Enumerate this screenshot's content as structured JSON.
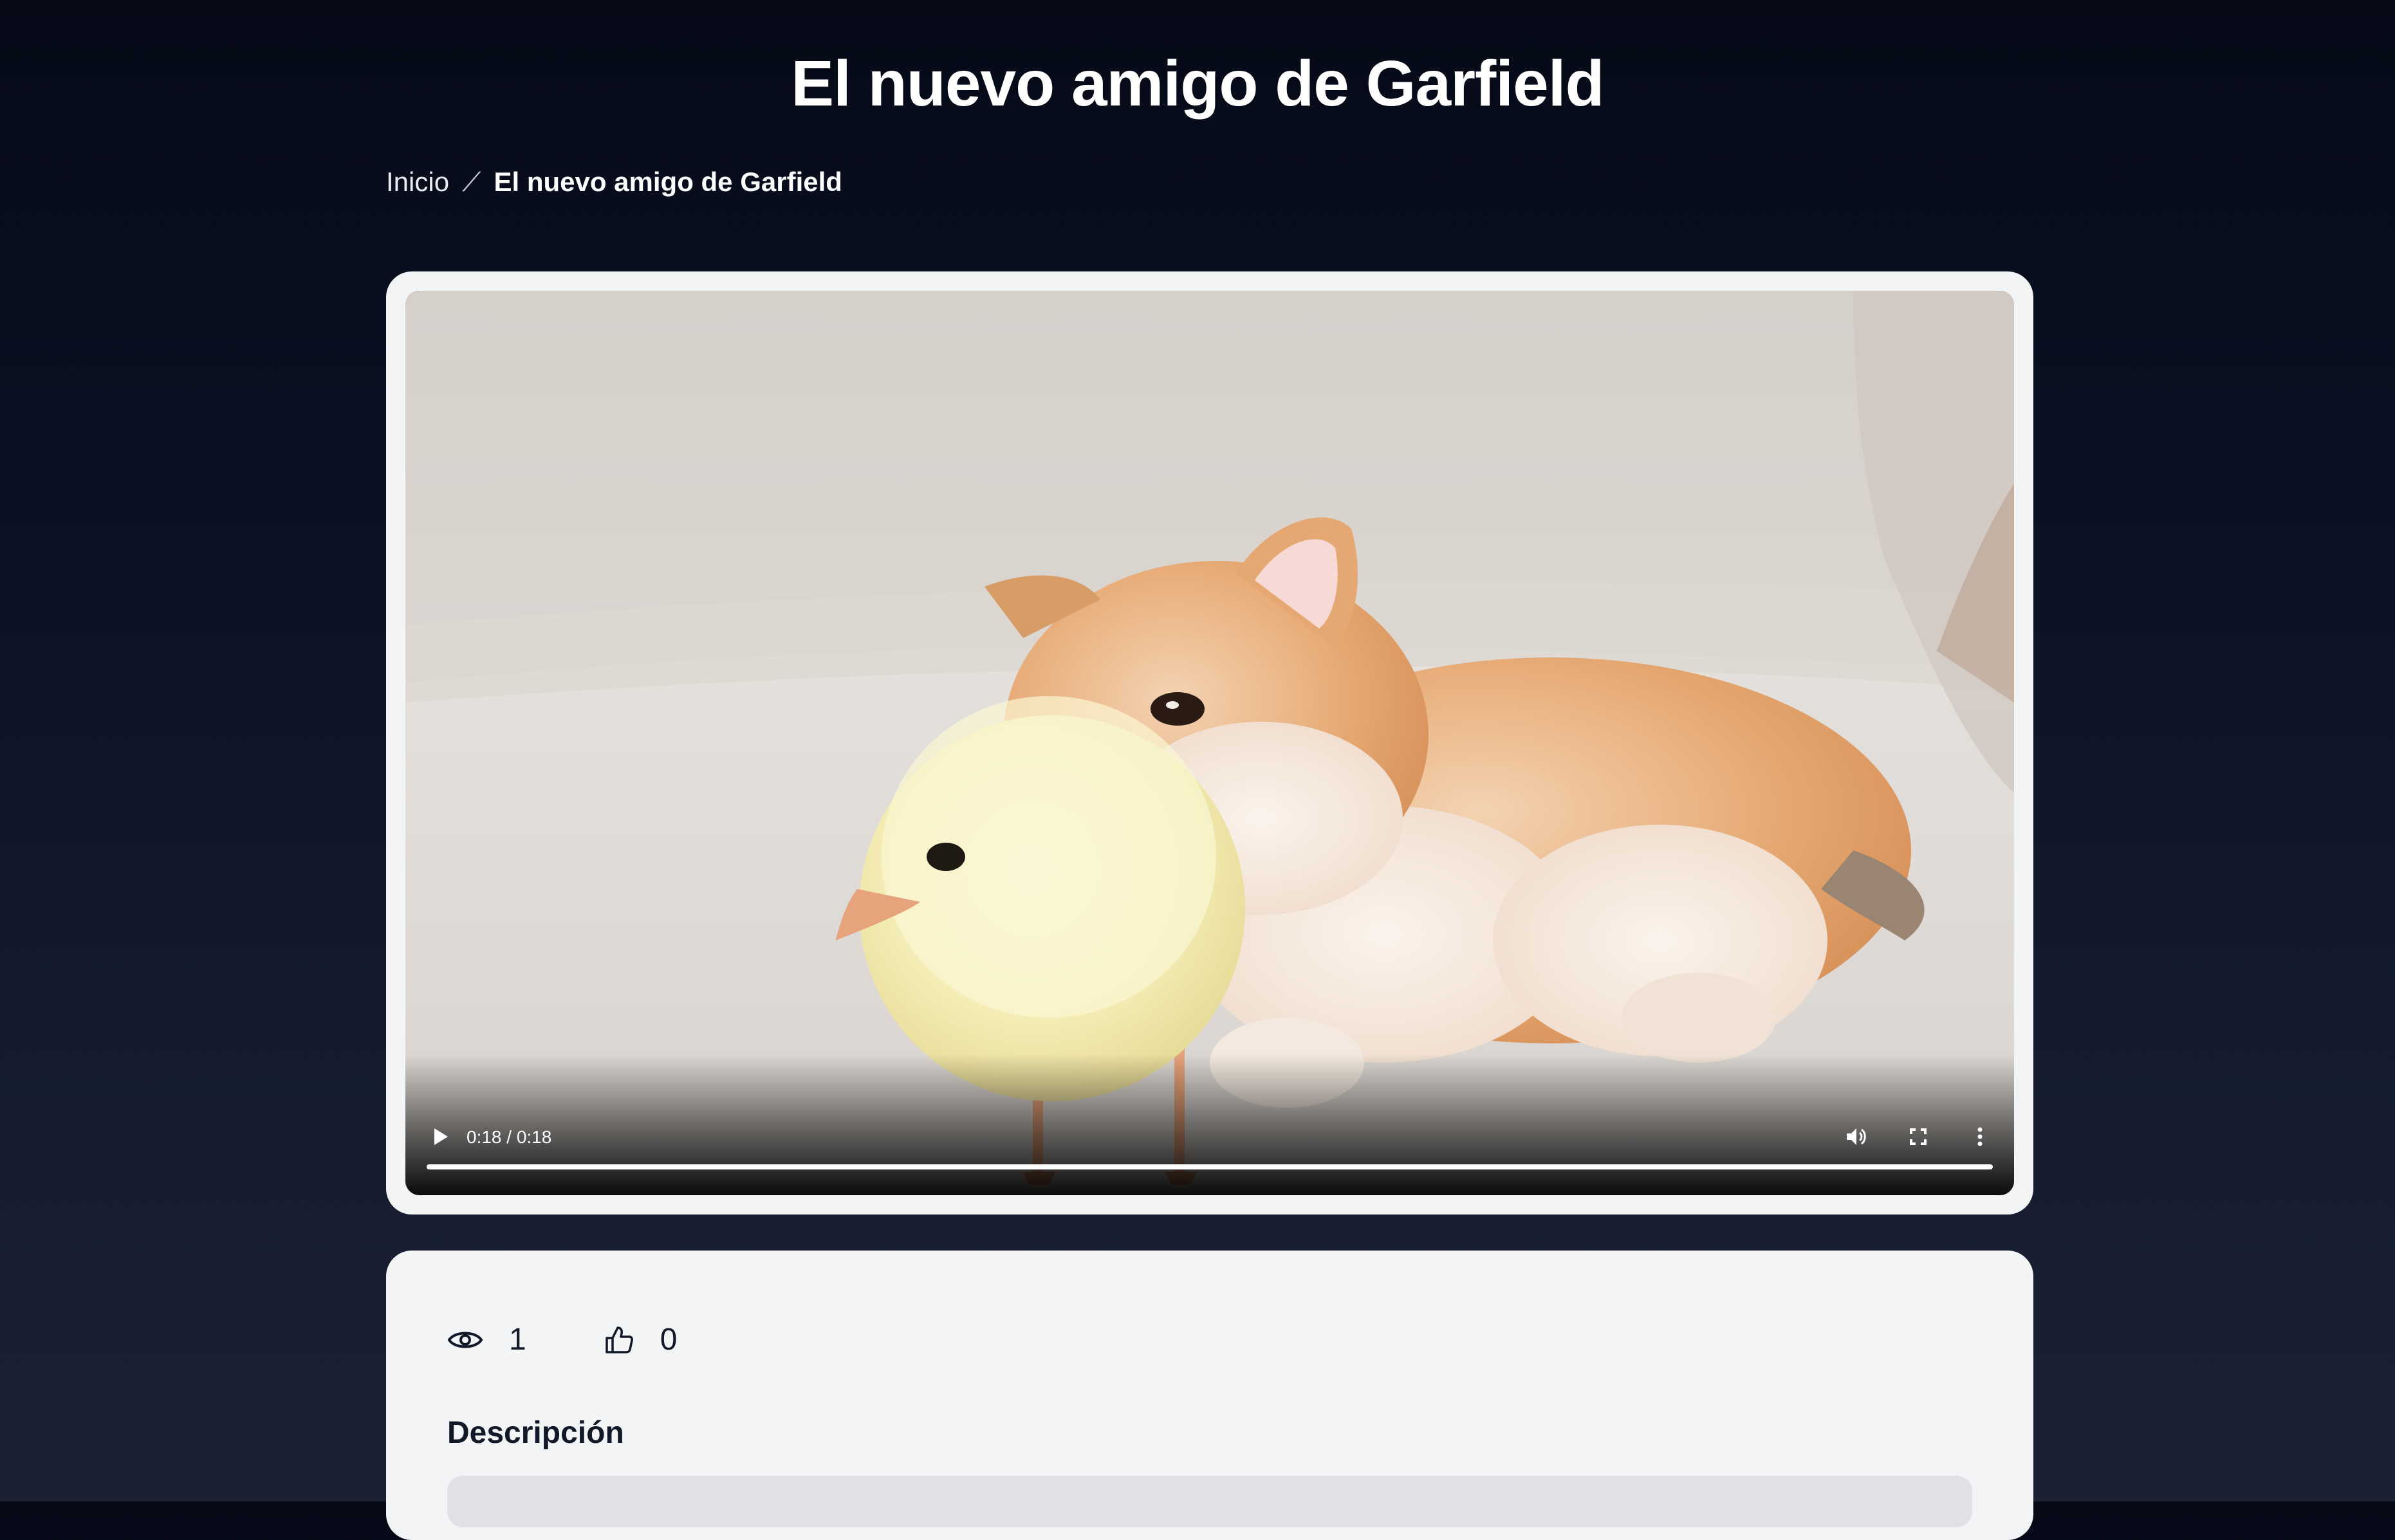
{
  "page": {
    "title": "El nuevo amigo de Garfield"
  },
  "breadcrumb": {
    "home": "Inicio",
    "separator": "⟋",
    "current": "El nuevo amigo de Garfield"
  },
  "video": {
    "time": "0:18 / 0:18",
    "progress": 1.0,
    "icons": [
      "play-icon",
      "volume-icon",
      "fullscreen-icon",
      "more-vert-icon"
    ]
  },
  "stats": {
    "views": "1",
    "likes": "0"
  },
  "description": {
    "heading": "Descripción"
  },
  "colors": {
    "card_bg": "#f3f4f6",
    "page_bg_top": "#060a17",
    "page_bg_bottom": "#1a2133",
    "text_dark": "#111827"
  }
}
